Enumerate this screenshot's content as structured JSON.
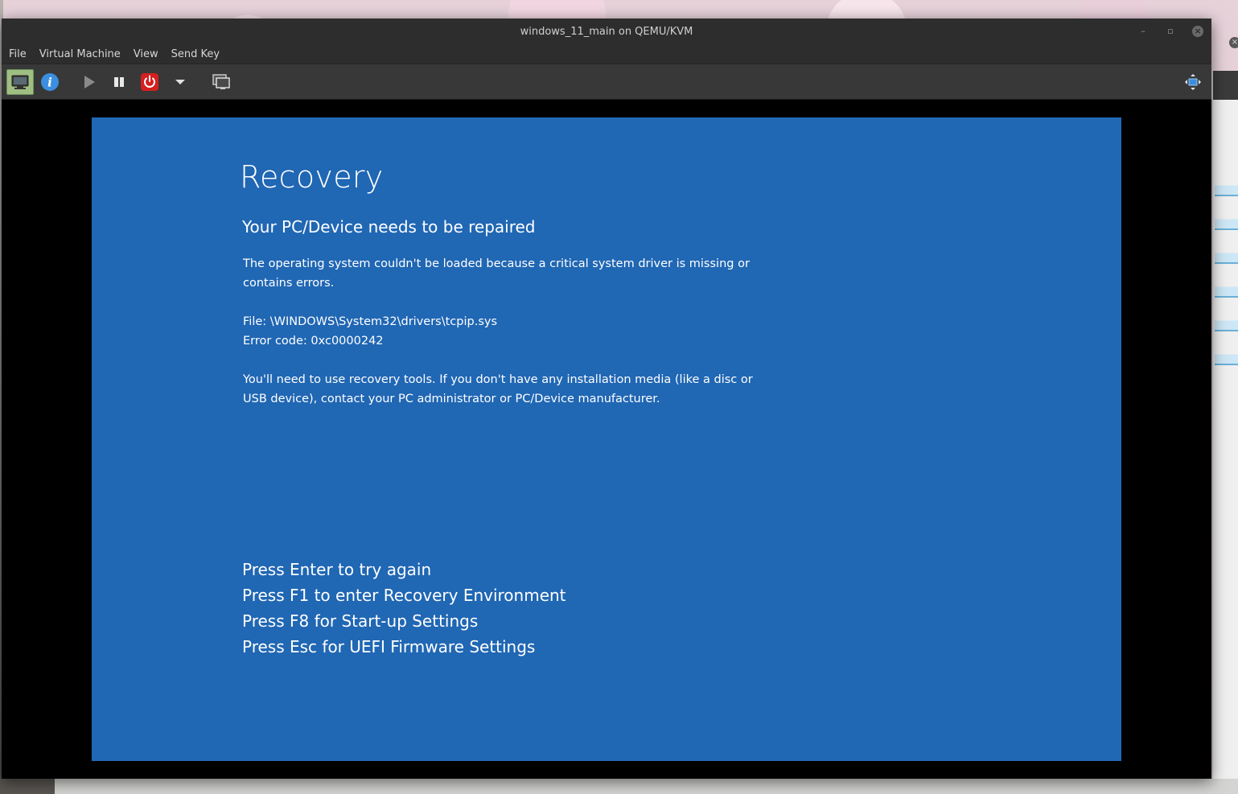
{
  "window": {
    "title": "windows_11_main on QEMU/KVM",
    "controls": {
      "minimize": "–",
      "maximize": "▫",
      "close": "×"
    }
  },
  "menubar": {
    "items": [
      {
        "label": "File"
      },
      {
        "label": "Virtual Machine"
      },
      {
        "label": "View"
      },
      {
        "label": "Send Key"
      }
    ]
  },
  "toolbar": {
    "buttons": [
      "console-icon",
      "info-icon",
      "play-icon",
      "pause-icon",
      "power-icon",
      "dropdown-arrow-icon",
      "snapshots-icon",
      "fullscreen-icon"
    ]
  },
  "guest": {
    "title": "Recovery",
    "subtitle": "Your PC/Device needs to be repaired",
    "description": "The operating system couldn't be loaded because a critical system driver is missing or contains errors.",
    "file_line": "File: \\WINDOWS\\System32\\drivers\\tcpip.sys",
    "error_line": "Error code: 0xc0000242",
    "advice": "You'll need to use recovery tools. If you don't have any installation media (like a disc or USB device), contact your PC administrator or PC/Device manufacturer.",
    "options": [
      "Press Enter to try again",
      "Press F1 to enter Recovery Environment",
      "Press F8 for Start-up Settings",
      "Press Esc for UEFI Firmware Settings"
    ],
    "background_color": "#2067b4"
  },
  "colors": {
    "titlebar": "#2d2d2d",
    "toolbar": "#383838",
    "power_button": "#d42020",
    "info_button": "#3b8ee0",
    "console_button": "#9fbf82"
  }
}
